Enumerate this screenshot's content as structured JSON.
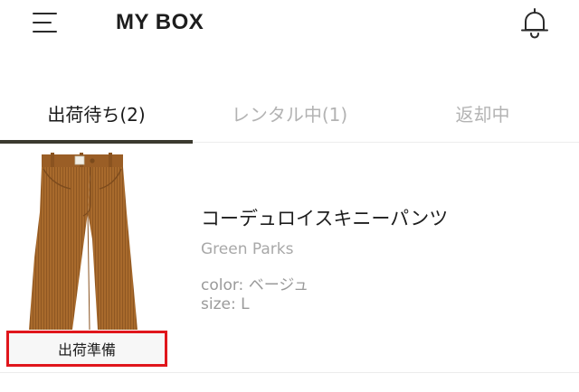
{
  "header": {
    "title": "MY BOX",
    "menu_icon": "hamburger-menu-icon",
    "notification_icon": "bell-icon"
  },
  "tabs": [
    {
      "label": "出荷待ち(2)",
      "active": true
    },
    {
      "label": "レンタル中(1)",
      "active": false
    },
    {
      "label": "返却中",
      "active": false
    }
  ],
  "items": [
    {
      "name": "コーデュロイスキニーパンツ",
      "brand": "Green Parks",
      "color": "color: ベージュ",
      "size": "size: L",
      "status": "出荷準備",
      "image": "brown-corduroy-pants"
    }
  ],
  "colors": {
    "active_tab_underline": "#3b3a2f",
    "inactive_tab_text": "#b3b3b3",
    "status_border": "#e0161c",
    "pants_brown": "#a86a2c"
  }
}
